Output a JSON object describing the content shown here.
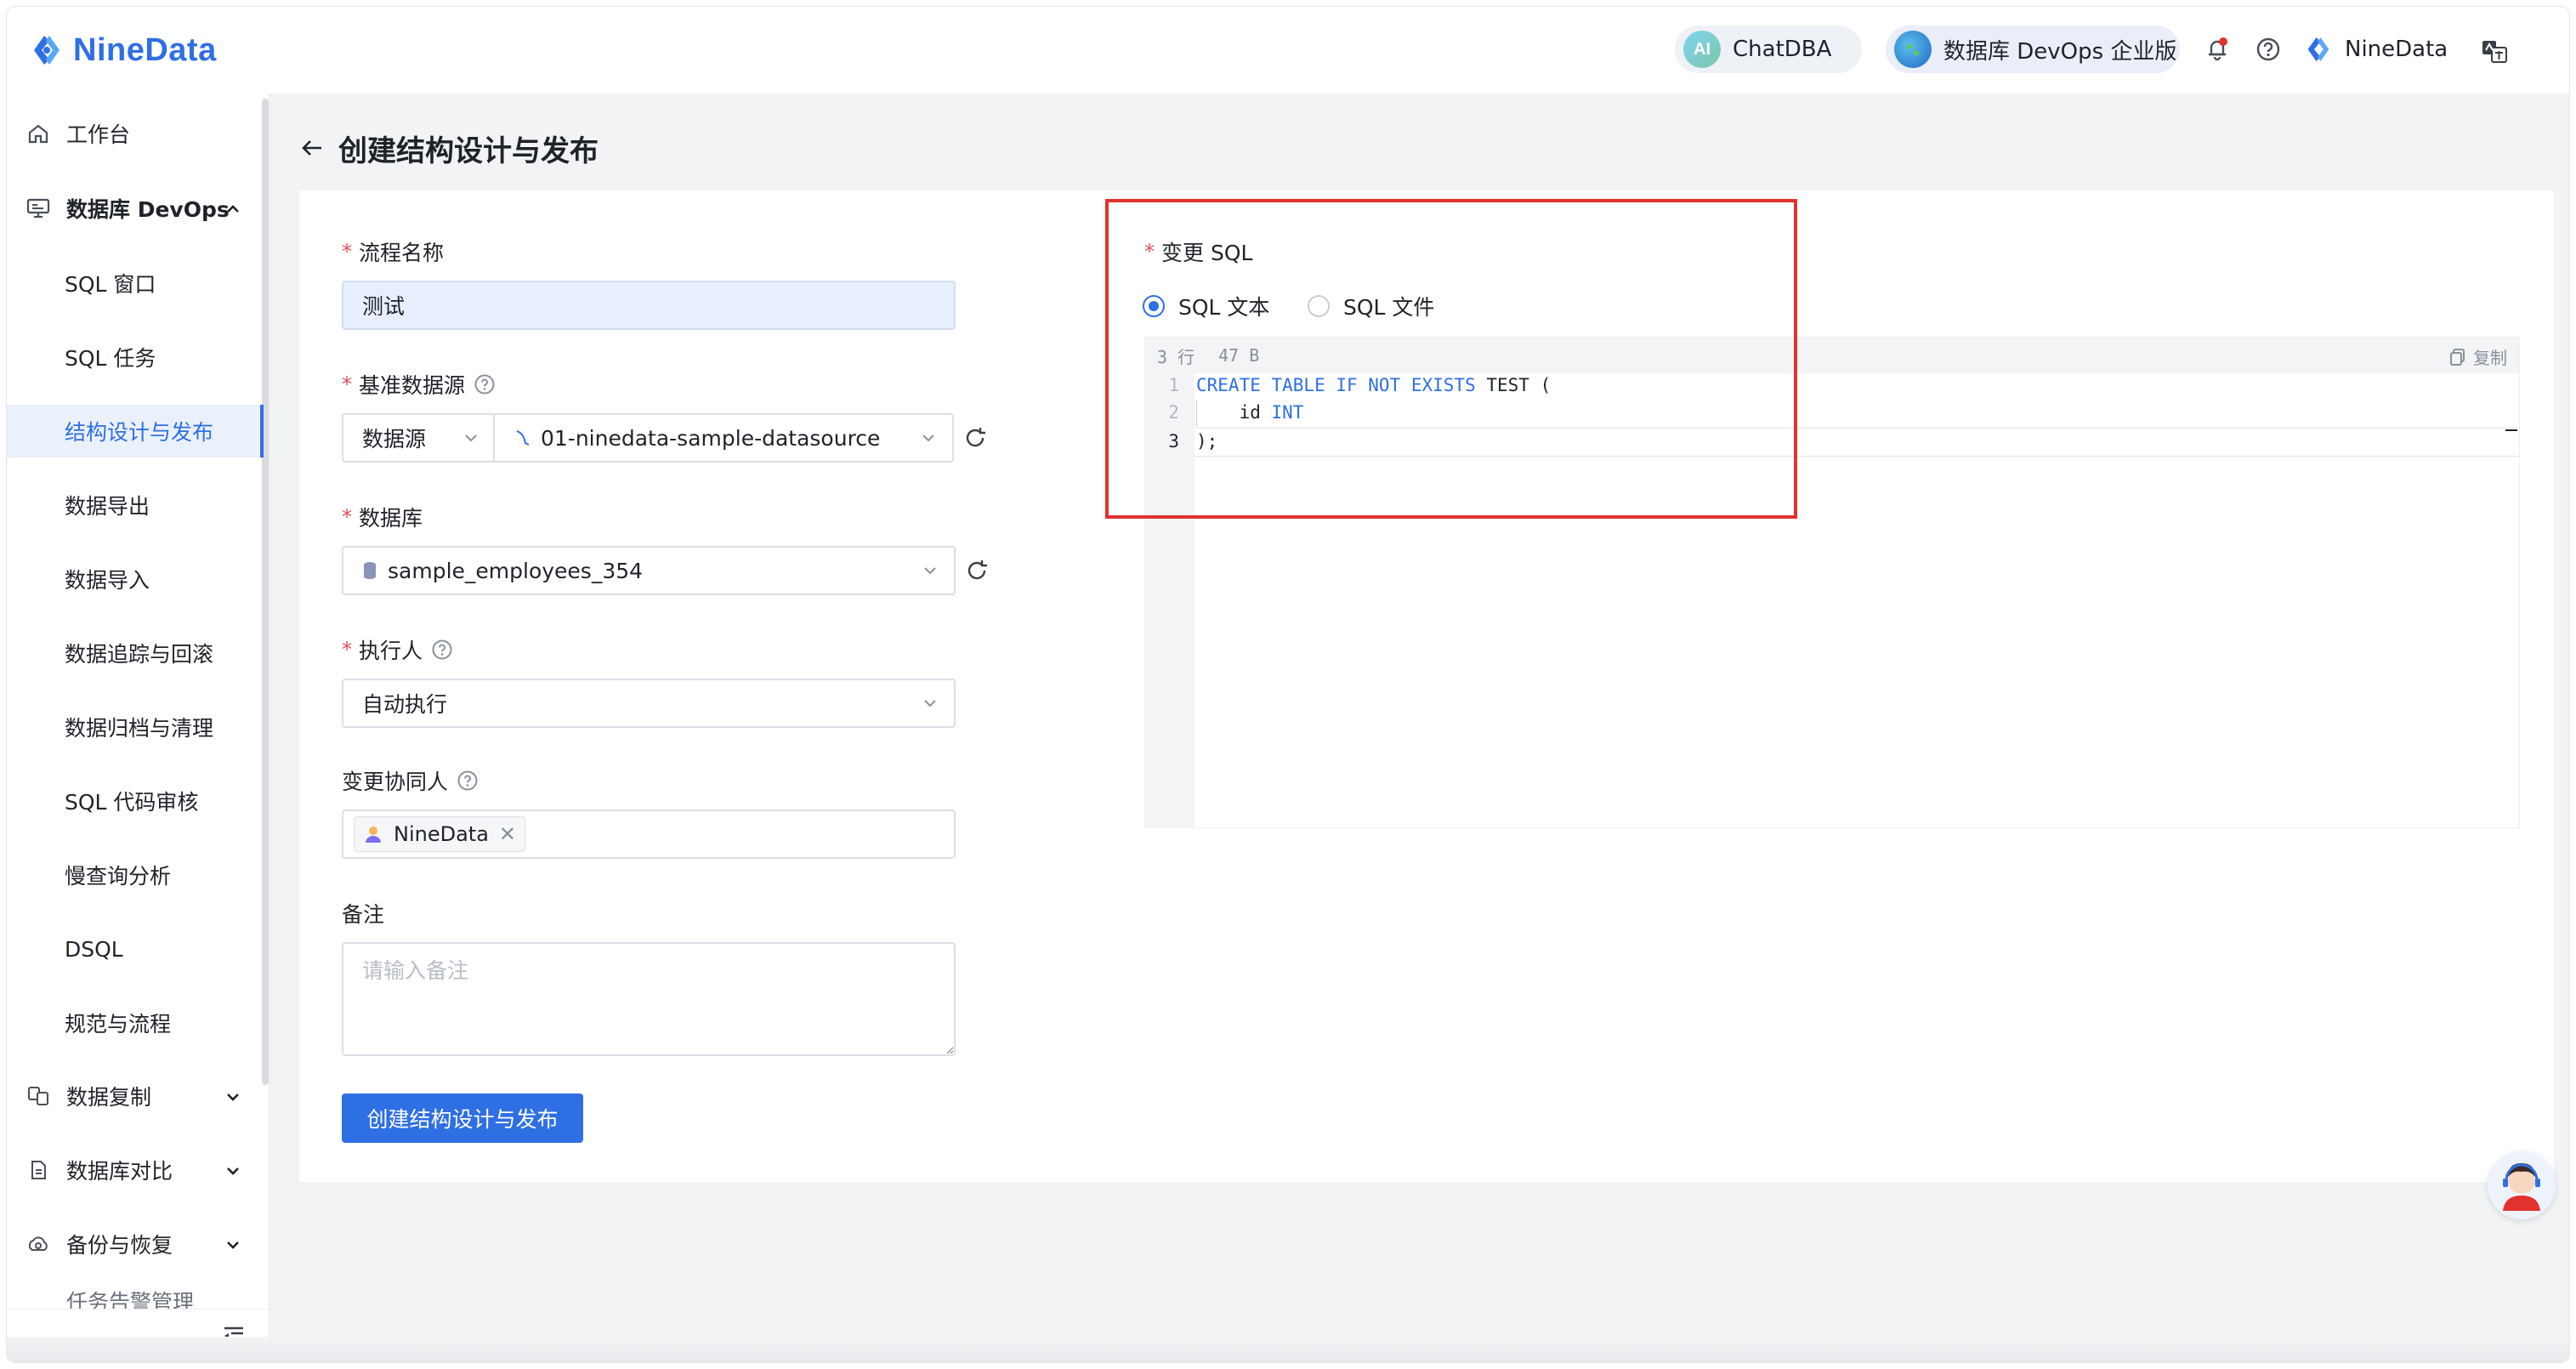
{
  "header": {
    "brand": "NineData",
    "chatdba": "ChatDBA",
    "devops_edition": "数据库 DevOps 企业版",
    "user": "NineData",
    "icons": [
      "bell-icon",
      "help-icon",
      "language-icon"
    ]
  },
  "sidebar": {
    "workbench": "工作台",
    "devops_group": "数据库 DevOps",
    "children": [
      "SQL 窗口",
      "SQL 任务",
      "结构设计与发布",
      "数据导出",
      "数据导入",
      "数据追踪与回滚",
      "数据归档与清理",
      "SQL 代码审核",
      "慢查询分析",
      "DSQL",
      "规范与流程"
    ],
    "groups": [
      "数据复制",
      "数据库对比",
      "备份与恢复"
    ],
    "partial_item": "任务告警管理",
    "active_item": "结构设计与发布"
  },
  "page": {
    "title": "创建结构设计与发布"
  },
  "form": {
    "flow_name_label": "流程名称",
    "flow_name_value": "测试",
    "datasource_label": "基准数据源",
    "datasource_type": "数据源",
    "datasource_value": "01-ninedata-sample-datasource",
    "database_label": "数据库",
    "database_value": "sample_employees_354",
    "executor_label": "执行人",
    "executor_value": "自动执行",
    "collaborator_label": "变更协同人",
    "collaborator_tag": "NineData",
    "note_label": "备注",
    "note_placeholder": "请输入备注",
    "submit": "创建结构设计与发布"
  },
  "sql": {
    "label": "变更 SQL",
    "option_text": "SQL 文本",
    "option_file": "SQL 文件",
    "selected": "SQL 文本",
    "lines_count": "3 行",
    "size": "47 B",
    "copy": "复制",
    "line_numbers": [
      "1",
      "2",
      "3"
    ],
    "code": {
      "l1_kw": "CREATE TABLE IF NOT EXISTS",
      "l1_rest": " TEST (",
      "l2_ident": "    id ",
      "l2_type": "INT",
      "l3": ");"
    }
  },
  "colors": {
    "accent": "#2f6fe4",
    "highlight_box": "#e2322d",
    "required": "#e34d59"
  }
}
